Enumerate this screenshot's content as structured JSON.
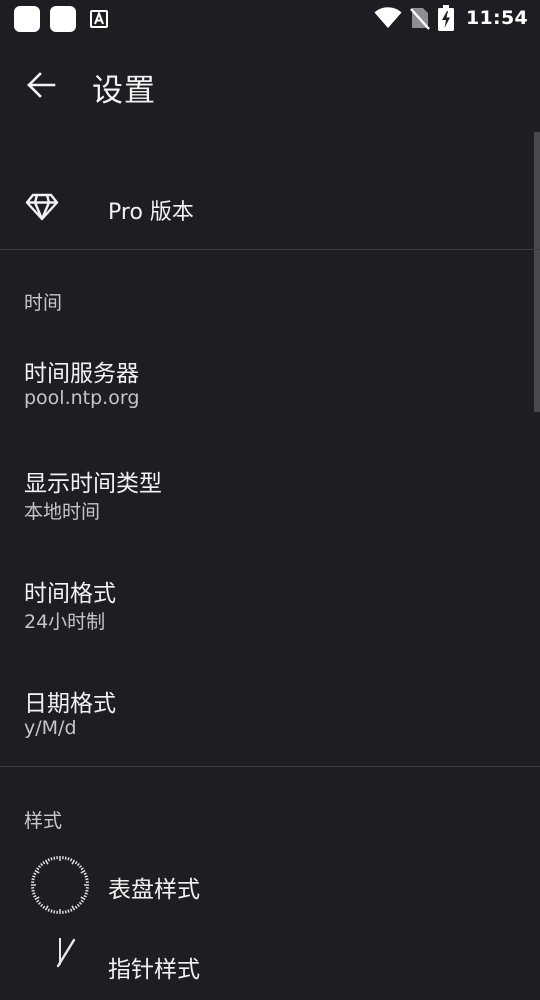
{
  "status_bar": {
    "time": "11:54",
    "icons": [
      "notification-square-icon",
      "notification-square-icon",
      "app-a-notification-icon",
      "wifi-icon",
      "no-sim-icon",
      "battery-charging-icon"
    ]
  },
  "app_bar": {
    "title": "设置",
    "back_icon": "arrow-left-icon"
  },
  "pro": {
    "label": "Pro 版本",
    "icon": "diamond-icon"
  },
  "time_section": {
    "header": "时间",
    "items": [
      {
        "title": "时间服务器",
        "summary": "pool.ntp.org"
      },
      {
        "title": "显示时间类型",
        "summary": "本地时间"
      },
      {
        "title": "时间格式",
        "summary": "24小时制"
      },
      {
        "title": "日期格式",
        "summary": "y/M/d"
      }
    ]
  },
  "style_section": {
    "header": "样式",
    "items": [
      {
        "label": "表盘样式",
        "icon": "dial-icon"
      },
      {
        "label": "指针样式",
        "icon": "clock-hand-icon"
      }
    ]
  },
  "colors": {
    "background": "#1e1d22",
    "text_primary": "#f2f2f4",
    "text_secondary": "#c5c4ca",
    "divider": "#3c3b41",
    "scrollbar": "#4a4950"
  }
}
